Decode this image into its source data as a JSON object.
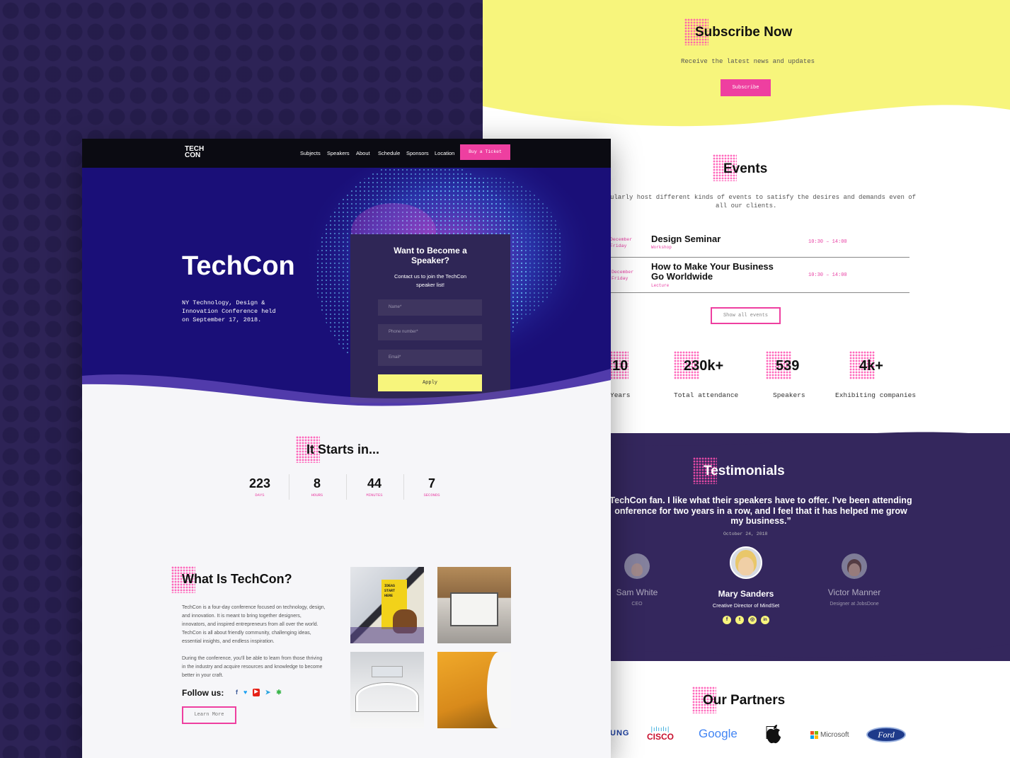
{
  "subscribe": {
    "title": "Subscribe Now",
    "subtitle": "Receive the latest news and updates",
    "button": "Subscribe"
  },
  "events": {
    "title": "Events",
    "intro_line1": "ularly host different kinds of events to satisfy the desires and demands even of",
    "intro_line2": "all our clients.",
    "items": [
      {
        "date1": "December",
        "date2": "Friday",
        "name": "Design Seminar",
        "type": "Workshop",
        "time": "10:30 – 14:00"
      },
      {
        "date1": "December",
        "date2": "Friday",
        "name_line1": "How to Make Your Business",
        "name_line2": "Go Worldwide",
        "type": "Lecture",
        "time": "10:30 – 14:00"
      }
    ],
    "show_all": "Show all events"
  },
  "stats": [
    {
      "num": "10",
      "label": "Years"
    },
    {
      "num": "230k+",
      "label": "Total attendance"
    },
    {
      "num": "539",
      "label": "Speakers"
    },
    {
      "num": "4k+",
      "label": "Exhibiting companies"
    }
  ],
  "testimonials": {
    "title": "Testimonials",
    "quote_line1": "TechCon fan. I like what their speakers have to offer. I've been attending",
    "quote_line2": "onference for two years in a row, and I feel that it has helped me grow",
    "quote_line3": "my business.”",
    "date": "October 24, 2018",
    "people": [
      {
        "name": "Sam White",
        "role": "CEO"
      },
      {
        "name": "Mary Sanders",
        "role": "Creative Director of MindSet"
      },
      {
        "name": "Victor Manner",
        "role": "Designer at JobsDone"
      }
    ]
  },
  "partners": {
    "title": "Our Partners",
    "logos": [
      "UNG",
      "CISCO",
      "Google",
      "Microsoft",
      "Ford"
    ]
  },
  "nav": {
    "logo_line1": "TECH",
    "logo_line2": "CON",
    "links": [
      "Subjects",
      "Speakers",
      "About",
      "Schedule",
      "Sponsors",
      "Location"
    ],
    "cta": "Buy a Ticket"
  },
  "hero": {
    "title": "TechCon",
    "subtitle_line1": "NY Technology, Design &",
    "subtitle_line2": "Innovation Conference held",
    "subtitle_line3": "on September 17, 2018."
  },
  "speaker_form": {
    "title_line1": "Want to Become a",
    "title_line2": "Speaker?",
    "desc_line1": "Contact us to join the TechCon",
    "desc_line2": "speaker list!",
    "name_placeholder": "Name*",
    "phone_placeholder": "Phone number*",
    "email_placeholder": "Email*",
    "apply": "Apply"
  },
  "countdown": {
    "title": "It Starts in...",
    "items": [
      {
        "num": "223",
        "label": "DAYS"
      },
      {
        "num": "8",
        "label": "HOURS"
      },
      {
        "num": "44",
        "label": "MINUTES"
      },
      {
        "num": "7",
        "label": "SECONDS"
      }
    ]
  },
  "about": {
    "title": "What Is TechCon?",
    "p1": [
      "TechCon is a four-day conference focused on technology, design,",
      "and innovation. It is meant to bring together designers,",
      "innovators, and inspired entrepreneurs from all over the world.",
      "TechCon is all about friendly community, challenging ideas,",
      "essential insights, and endless inspiration."
    ],
    "p2": [
      "During the conference, you'll be able to learn from those thriving",
      "in the industry and acquire resources and knowledge to become",
      "better in your craft."
    ],
    "follow": "Follow us:",
    "learn_more": "Learn More",
    "sign_text": "IDEAS START HERE"
  },
  "colors": {
    "accent": "#e83fa3",
    "yellow": "#f7f57c",
    "purple": "#2d2356",
    "navy_hero": "#1a0f78"
  }
}
